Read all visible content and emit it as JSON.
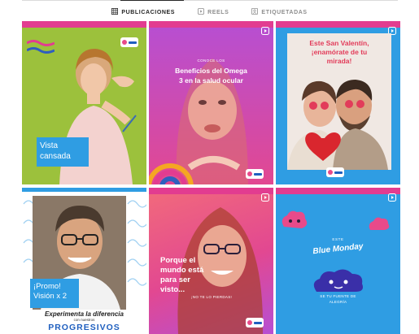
{
  "tabs": [
    {
      "label": "PUBLICACIONES",
      "icon": "grid-icon",
      "active": true
    },
    {
      "label": "REELS",
      "icon": "reels-icon",
      "active": false
    },
    {
      "label": "ETIQUETADAS",
      "icon": "tagged-icon",
      "active": false
    }
  ],
  "posts": [
    {
      "label": "Vista cansada",
      "label_lines": [
        "Vista",
        "cansada"
      ]
    },
    {
      "eyebrow": "CONOCE LOS",
      "title_lines": [
        "Beneficios del Omega",
        "3 en la salud ocular"
      ]
    },
    {
      "title_lines": [
        "Este San Valentín,",
        "¡enamórate de tu",
        "mirada!"
      ]
    },
    {
      "label_lines": [
        "¡Promo!",
        "Visión x 2"
      ],
      "experimenta": "Experimenta la diferencia",
      "con_nuestros": "con nuestros",
      "progresivos": "PROGRESIVOS"
    },
    {
      "title_lines": [
        "Porque el",
        "mundo está",
        "para ser",
        "visto..."
      ],
      "caption": "¡NO TE LO PIERDAS!"
    },
    {
      "eyebrow": "ESTE",
      "title": "Blue Monday",
      "subtitle_lines": [
        "SE TU FUENTE DE",
        "ALEGRÍA"
      ]
    }
  ],
  "colors": {
    "brand_pink": "#e23c90",
    "brand_blue": "#2f9de3",
    "accent_red": "#e23c5a",
    "navy": "#1f5fbf"
  }
}
